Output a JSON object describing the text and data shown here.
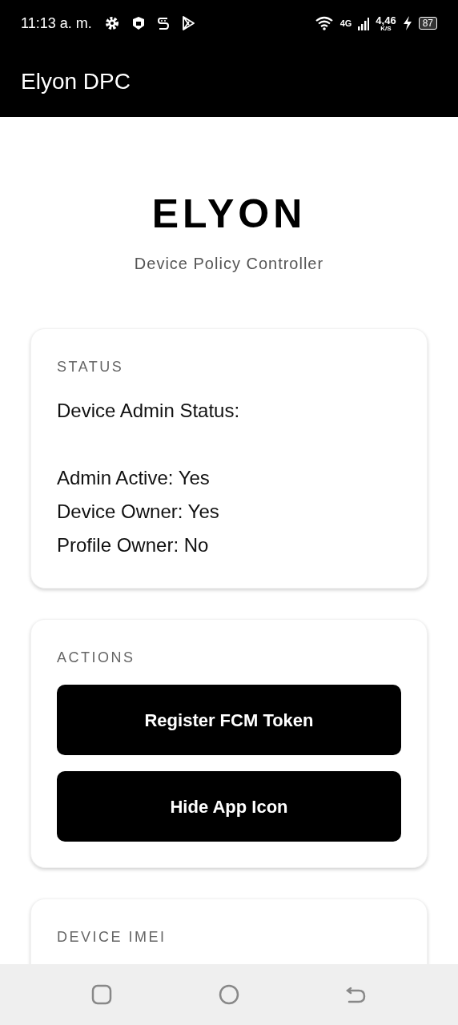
{
  "status_bar": {
    "time": "11:13 a. m.",
    "network": "4G",
    "speed": "4,46",
    "speed_unit": "K/S",
    "battery": "87",
    "charging": true
  },
  "app_bar": {
    "title": "Elyon DPC"
  },
  "header": {
    "title": "ELYON",
    "subtitle": "Device Policy Controller"
  },
  "cards": [
    {
      "kind": "info",
      "title": "STATUS",
      "heading": "Device Admin Status:",
      "lines": [
        "Admin Active: Yes",
        "Device Owner: Yes",
        "Profile Owner: No"
      ]
    },
    {
      "kind": "actions",
      "title": "ACTIONS",
      "buttons": [
        "Register FCM Token",
        "Hide App Icon"
      ]
    },
    {
      "kind": "info",
      "title": "DEVICE IMEI"
    }
  ]
}
